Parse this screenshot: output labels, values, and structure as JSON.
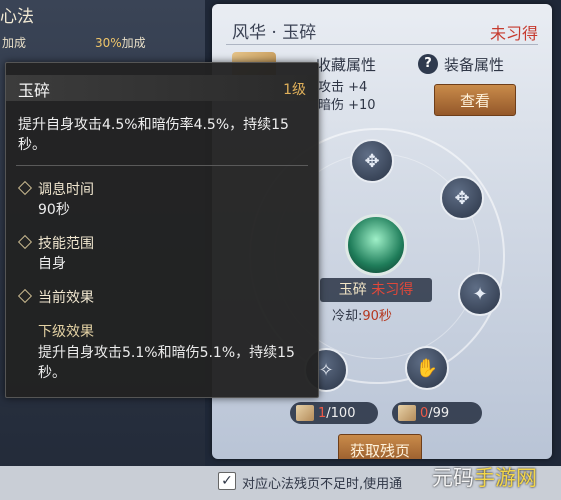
{
  "left_panel": {
    "title": "心法",
    "bonus_a": "加成",
    "bonus_b_value": "30%",
    "bonus_b_label": "加成"
  },
  "right_panel": {
    "title": "风华 · 玉碎",
    "status": "未习得",
    "collect_label": "收藏属性",
    "stat_1": "攻击 +4",
    "stat_2": "暗伤 +10",
    "help_icon": "?",
    "equip_label": "装备属性",
    "view_button": "查看",
    "skill_name": "玉碎",
    "skill_status": "未习得",
    "cooldown_label": "冷却:",
    "cooldown_value": "90秒",
    "pages_1_current": "1",
    "pages_1_total": "/100",
    "pages_2_current": "0",
    "pages_2_total": "/99",
    "get_button": "获取残页"
  },
  "bottom_bar": {
    "checkbox_mark": "✓",
    "text": "对应心法残页不足时,使用通"
  },
  "watermark": {
    "text_a": "元码",
    "text_b": "手游网"
  },
  "tooltip": {
    "title": "玉碎",
    "level": "1级",
    "description": "提升自身攻击4.5%和暗伤率4.5%，持续15秒。",
    "cooldown_label": "调息时间",
    "cooldown_value": "90秒",
    "range_label": "技能范围",
    "range_value": "自身",
    "effect_label": "当前效果",
    "next_label": "下级效果",
    "next_description": "提升自身攻击5.1%和暗伤5.1%，持续15秒。"
  },
  "icons": {
    "nodes": [
      "skill-node-icon",
      "skill-node-icon",
      "skill-node-icon",
      "skill-node-icon",
      "skill-node-icon"
    ],
    "center": "jade-skill-icon",
    "book": "book-icon"
  },
  "colors": {
    "accent_red": "#c63a2e",
    "button_brown": "#b07138",
    "tooltip_bg": "#222222",
    "gold": "#e0b05a"
  }
}
